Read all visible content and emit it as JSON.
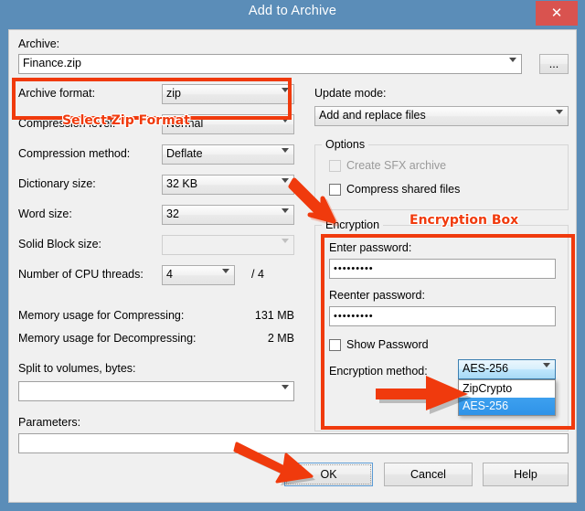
{
  "window": {
    "title": "Add to Archive",
    "close_label": "✕"
  },
  "archive": {
    "label": "Archive:",
    "value": "Finance.zip",
    "browse_label": "..."
  },
  "left_fields": [
    {
      "label": "Archive format:",
      "value": "zip"
    },
    {
      "label": "Compression level:",
      "value": "Normal"
    },
    {
      "label": "Compression method:",
      "value": "Deflate"
    },
    {
      "label": "Dictionary size:",
      "value": "32 KB"
    },
    {
      "label": "Word size:",
      "value": "32"
    },
    {
      "label": "Solid Block size:",
      "value": ""
    },
    {
      "label": "Number of CPU threads:",
      "value": "4"
    }
  ],
  "cpu_threads_total": "/ 4",
  "memory": [
    {
      "label": "Memory usage for Compressing:",
      "value": "131 MB"
    },
    {
      "label": "Memory usage for Decompressing:",
      "value": "2 MB"
    }
  ],
  "split": {
    "label": "Split to volumes, bytes:",
    "value": ""
  },
  "parameters": {
    "label": "Parameters:",
    "value": ""
  },
  "update_mode": {
    "label": "Update mode:",
    "value": "Add and replace files"
  },
  "options": {
    "group_title": "Options",
    "items": [
      {
        "label": "Create SFX archive",
        "checked": false,
        "disabled": true
      },
      {
        "label": "Compress shared files",
        "checked": false,
        "disabled": false
      }
    ]
  },
  "encryption": {
    "group_title": "Encryption",
    "enter_password_label": "Enter password:",
    "enter_password_value": "•••••••••",
    "reenter_password_label": "Reenter password:",
    "reenter_password_value": "•••••••••",
    "show_password_label": "Show Password",
    "show_password_checked": false,
    "method_label": "Encryption method:",
    "method_value": "AES-256",
    "method_options": [
      "ZipCrypto",
      "AES-256"
    ],
    "method_selected": "AES-256"
  },
  "buttons": {
    "ok": "OK",
    "cancel": "Cancel",
    "help": "Help"
  },
  "annotations": {
    "zip_format_text": "Select Zip Format",
    "encryption_box_text": "Encryption Box",
    "accent_color": "#f03a0d"
  }
}
